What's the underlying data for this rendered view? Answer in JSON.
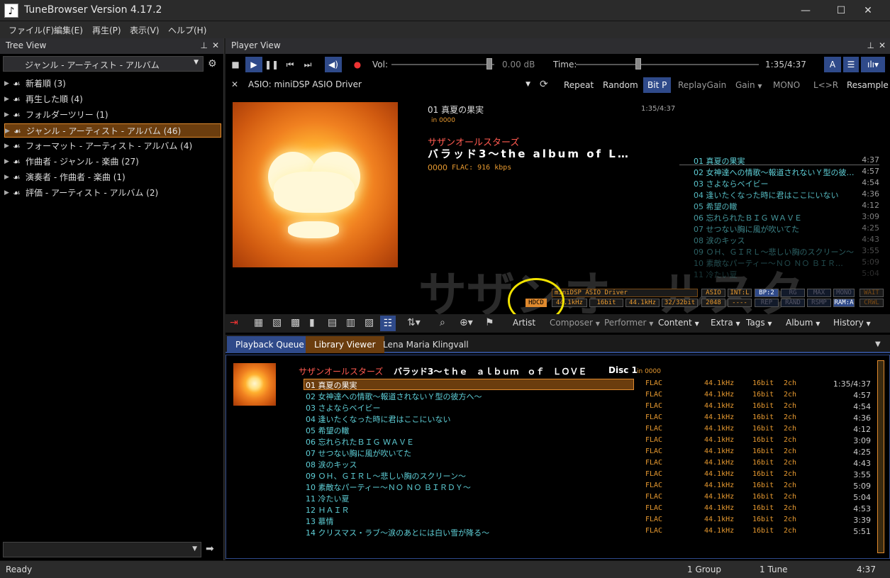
{
  "app": {
    "title": "TuneBrowser Version 4.17.2",
    "icon": "music-note-icon"
  },
  "menu": [
    "ファイル(F)",
    "編集(E)",
    "再生(P)",
    "表示(V)",
    "ヘルプ(H)"
  ],
  "tree": {
    "header": "Tree View",
    "selector": "ジャンル - アーティスト - アルバム",
    "items": [
      {
        "label": "新着順 (3)"
      },
      {
        "label": "再生した順 (4)"
      },
      {
        "label": "フォルダーツリー (1)"
      },
      {
        "label": "ジャンル - アーティスト - アルバム (46)"
      },
      {
        "label": "フォーマット - アーティスト - アルバム (4)"
      },
      {
        "label": "作曲者 - ジャンル - 楽曲 (27)"
      },
      {
        "label": "演奏者 - 作曲者 - 楽曲 (1)"
      },
      {
        "label": "評価 - アーティスト - アルバム (2)"
      }
    ],
    "selected_index": 3
  },
  "player": {
    "header": "Player View",
    "vol_label": "Vol:",
    "vol_value": "0.00 dB",
    "time_label": "Time:",
    "time_value": "1:35/4:37",
    "volume_level": 0.95,
    "time_progress": 0.343,
    "device": "ASIO: miniDSP ASIO Driver",
    "buttons": [
      "Repeat",
      "Random",
      "Bit P",
      "ReplayGain",
      "Gain",
      "MONO",
      "L<>R",
      "Resample"
    ],
    "track_title": "01 真夏の果実",
    "track_time": "1:35/4:37",
    "in_label": "in 0000",
    "artist": "サザンオールスターズ",
    "album": "バラッド3～the album of L…",
    "year": "0000",
    "format": "FLAC: 916 kbps",
    "bg_text": "サザンオールスタ"
  },
  "np_list": [
    {
      "t": "01 真夏の果実",
      "d": "4:37"
    },
    {
      "t": "02 女神達への情歌～報道されないＹ型の彼…",
      "d": "4:57"
    },
    {
      "t": "03 さよならベイビー",
      "d": "4:54"
    },
    {
      "t": "04 逢いたくなった時に君はここにいない",
      "d": "4:36"
    },
    {
      "t": "05 希望の轍",
      "d": "4:12"
    },
    {
      "t": "06 忘れられたＢＩＧ ＷＡＶＥ",
      "d": "3:09"
    },
    {
      "t": "07 せつない胸に風が吹いてた",
      "d": "4:25"
    },
    {
      "t": "08 涙のキッス",
      "d": "4:43"
    },
    {
      "t": "09 ＯＨ、ＧＩＲＬ～悲しい胸のスクリーン～",
      "d": "3:55"
    },
    {
      "t": "10 素敵なパーティー～ＮＯ ＮＯ ＢＩＲ…",
      "d": "5:09"
    },
    {
      "t": "11 冷たい夏",
      "d": "5:04"
    }
  ],
  "indicators": {
    "driver": "miniDSP ASIO Driver",
    "asio": "ASIO",
    "int": "INT:L",
    "bp": "BP:2",
    "rg": "RG",
    "max": "MAX",
    "mono": "MONO",
    "wait": "WAIT",
    "hdcd": "HDCD",
    "rate1": "44.1kHz",
    "bits1": "16bit",
    "rate2": "44.1kHz",
    "bits2": "32/32bit",
    "buf": "2048",
    "dash": "----",
    "rep": "REP",
    "rand": "RAND",
    "rsmp": "RSMP",
    "ram": "RAM:A",
    "crwl": "CRWL"
  },
  "toolbar2": {
    "artist": "Artist",
    "composer": "Composer",
    "performer": "Performer",
    "content": "Content",
    "extra": "Extra",
    "tags": "Tags",
    "album": "Album",
    "history": "History"
  },
  "tabs": [
    "Playback Queue",
    "Library Viewer",
    "Lena Maria Klingvall"
  ],
  "queue": {
    "artist": "サザンオールスターズ",
    "album": "バラッド3～ｔｈｅ　ａｌｂｕｍ　ｏｆ　ＬＯＶＥ",
    "disc": "Disc 1",
    "in_label": "in 0000",
    "rows": [
      {
        "t": "01 真夏の果実",
        "f": "FLAC",
        "r": "44.1kHz",
        "b": "16bit",
        "c": "2ch",
        "d": "1:35/4:37"
      },
      {
        "t": "02 女神達への情歌～報道されないＹ型の彼方へ～",
        "f": "FLAC",
        "r": "44.1kHz",
        "b": "16bit",
        "c": "2ch",
        "d": "4:57"
      },
      {
        "t": "03 さよならベイビー",
        "f": "FLAC",
        "r": "44.1kHz",
        "b": "16bit",
        "c": "2ch",
        "d": "4:54"
      },
      {
        "t": "04 逢いたくなった時に君はここにいない",
        "f": "FLAC",
        "r": "44.1kHz",
        "b": "16bit",
        "c": "2ch",
        "d": "4:36"
      },
      {
        "t": "05 希望の轍",
        "f": "FLAC",
        "r": "44.1kHz",
        "b": "16bit",
        "c": "2ch",
        "d": "4:12"
      },
      {
        "t": "06 忘れられたＢＩＧ ＷＡＶＥ",
        "f": "FLAC",
        "r": "44.1kHz",
        "b": "16bit",
        "c": "2ch",
        "d": "3:09"
      },
      {
        "t": "07 せつない胸に風が吹いてた",
        "f": "FLAC",
        "r": "44.1kHz",
        "b": "16bit",
        "c": "2ch",
        "d": "4:25"
      },
      {
        "t": "08 涙のキッス",
        "f": "FLAC",
        "r": "44.1kHz",
        "b": "16bit",
        "c": "2ch",
        "d": "4:43"
      },
      {
        "t": "09 ＯＨ、ＧＩＲＬ～悲しい胸のスクリーン～",
        "f": "FLAC",
        "r": "44.1kHz",
        "b": "16bit",
        "c": "2ch",
        "d": "3:55"
      },
      {
        "t": "10 素敵なパーティー～ＮＯ ＮＯ ＢＩＲＤＹ～",
        "f": "FLAC",
        "r": "44.1kHz",
        "b": "16bit",
        "c": "2ch",
        "d": "5:09"
      },
      {
        "t": "11 冷たい夏",
        "f": "FLAC",
        "r": "44.1kHz",
        "b": "16bit",
        "c": "2ch",
        "d": "5:04"
      },
      {
        "t": "12 ＨＡＩＲ",
        "f": "FLAC",
        "r": "44.1kHz",
        "b": "16bit",
        "c": "2ch",
        "d": "4:53"
      },
      {
        "t": "13 慕情",
        "f": "FLAC",
        "r": "44.1kHz",
        "b": "16bit",
        "c": "2ch",
        "d": "3:39"
      },
      {
        "t": "14 クリスマス・ラブ～涙のあとには白い雪が降る～",
        "f": "FLAC",
        "r": "44.1kHz",
        "b": "16bit",
        "c": "2ch",
        "d": "5:51"
      }
    ]
  },
  "status": {
    "left": "Ready",
    "group": "1 Group",
    "tune": "1 Tune",
    "time": "4:37"
  },
  "colors": {
    "accent": "#e08a2e",
    "cyan": "#5fd0d8",
    "title_red": "#ff5a50",
    "callout": "#f1e200"
  }
}
